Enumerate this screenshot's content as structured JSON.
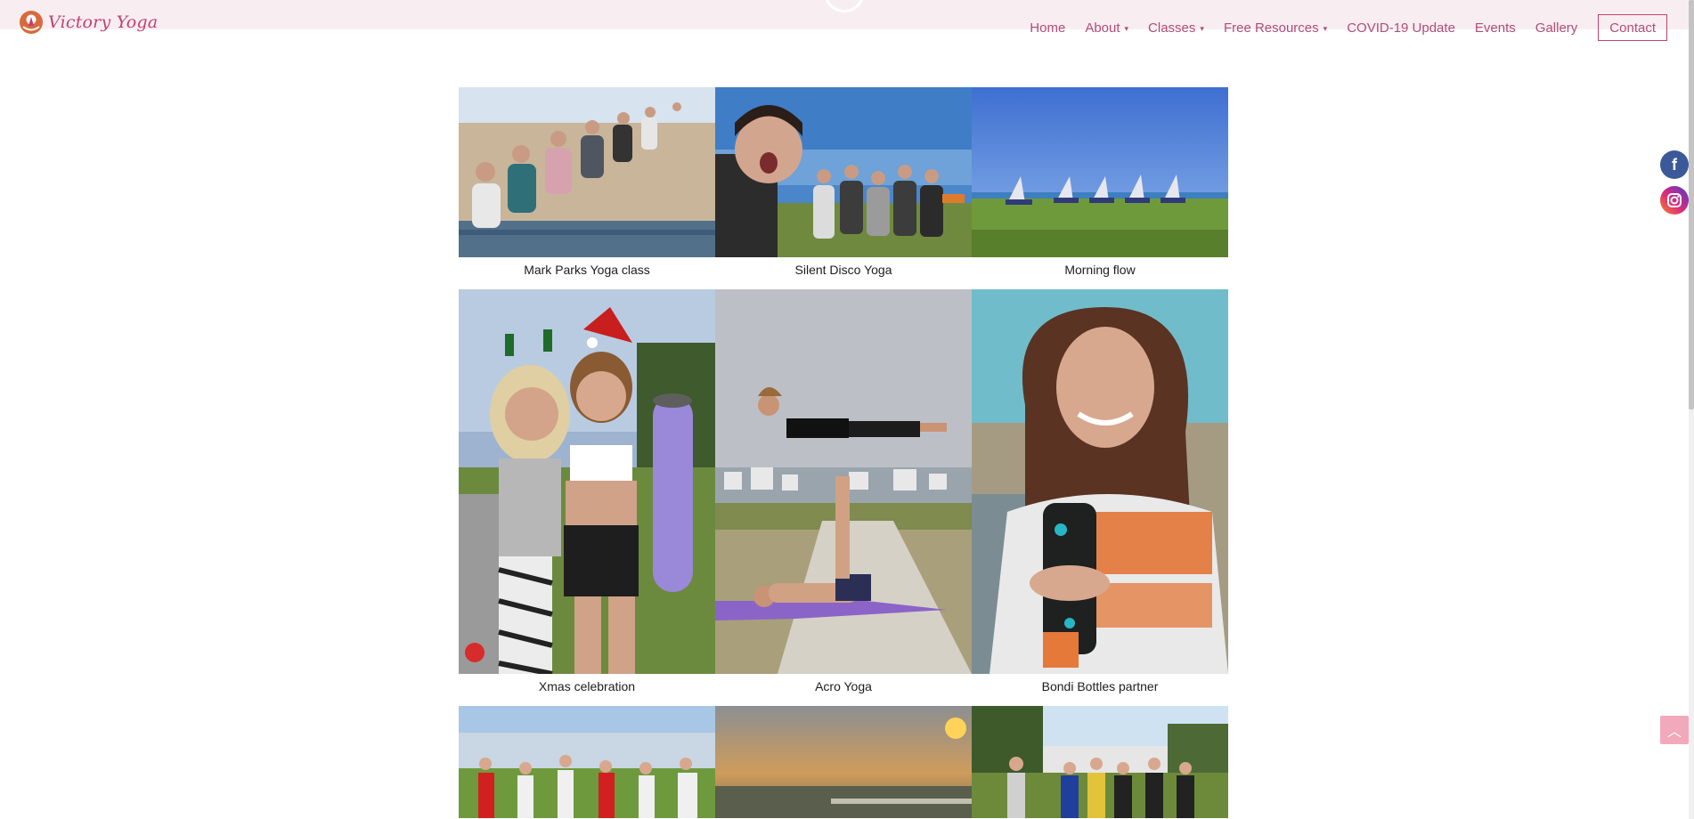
{
  "brand": {
    "name": "Victory Yoga",
    "accent": "#c2416d"
  },
  "nav": {
    "items": [
      {
        "label": "Home",
        "dropdown": false
      },
      {
        "label": "About",
        "dropdown": true
      },
      {
        "label": "Classes",
        "dropdown": true
      },
      {
        "label": "Free Resources",
        "dropdown": true
      },
      {
        "label": "COVID-19 Update",
        "dropdown": false
      },
      {
        "label": "Events",
        "dropdown": false
      },
      {
        "label": "Gallery",
        "dropdown": false
      }
    ],
    "contact_label": "Contact"
  },
  "gallery": {
    "rows": [
      {
        "items": [
          {
            "caption": "Mark Parks Yoga class"
          },
          {
            "caption": "Silent Disco Yoga"
          },
          {
            "caption": "Morning flow"
          }
        ]
      },
      {
        "items": [
          {
            "caption": "Xmas celebration"
          },
          {
            "caption": "Acro Yoga"
          },
          {
            "caption": "Bondi Bottles partner"
          }
        ]
      },
      {
        "items": [
          {
            "caption": ""
          },
          {
            "caption": ""
          },
          {
            "caption": ""
          }
        ]
      }
    ]
  },
  "social": {
    "icons": [
      "facebook-icon",
      "instagram-icon"
    ]
  },
  "back_to_top": {
    "icon": "chevron-up-icon"
  }
}
